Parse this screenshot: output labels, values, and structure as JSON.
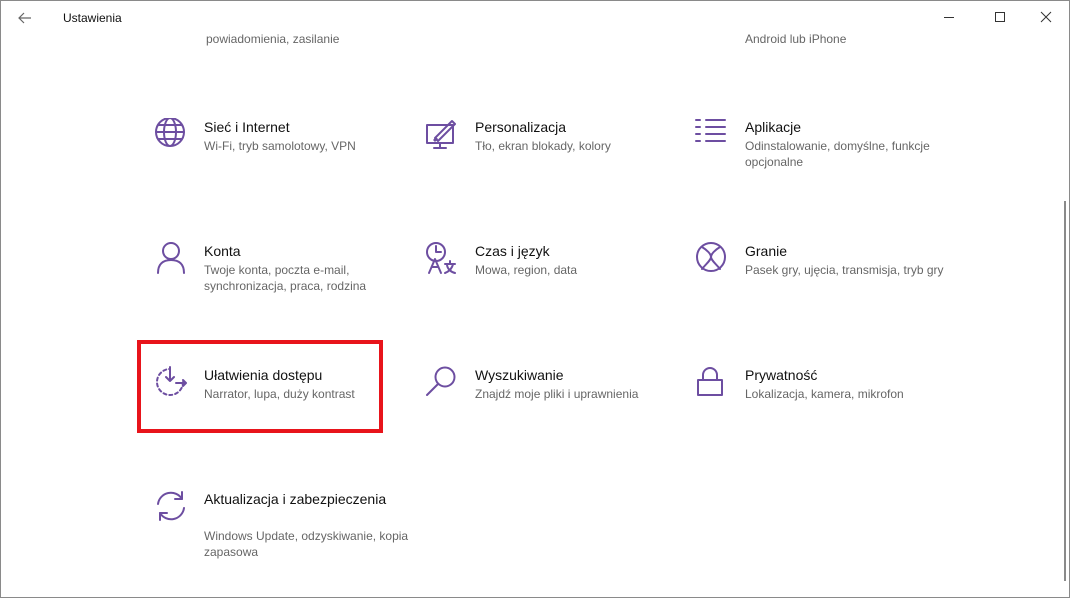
{
  "window": {
    "title": "Ustawienia"
  },
  "partial_row": {
    "left_desc": "powiadomienia, zasilanie",
    "right_desc": "Android lub iPhone"
  },
  "tiles": {
    "network": {
      "name": "Sieć i Internet",
      "desc": "Wi-Fi, tryb samolotowy, VPN",
      "icon": "globe-icon"
    },
    "personalization": {
      "name": "Personalizacja",
      "desc": "Tło, ekran blokady, kolory",
      "icon": "paint-icon"
    },
    "apps": {
      "name": "Aplikacje",
      "desc": "Odinstalowanie, domyślne, funkcje opcjonalne",
      "icon": "apps-list-icon"
    },
    "accounts": {
      "name": "Konta",
      "desc": "Twoje konta, poczta e-mail, synchronizacja, praca, rodzina",
      "icon": "person-icon"
    },
    "time": {
      "name": "Czas i język",
      "desc": "Mowa, region, data",
      "icon": "time-language-icon"
    },
    "gaming": {
      "name": "Granie",
      "desc": "Pasek gry, ujęcia, transmisja, tryb gry",
      "icon": "xbox-icon"
    },
    "ease": {
      "name": "Ułatwienia dostępu",
      "desc": "Narrator, lupa, duży kontrast",
      "icon": "ease-of-access-icon"
    },
    "search": {
      "name": "Wyszukiwanie",
      "desc": "Znajdź moje pliki i uprawnienia",
      "icon": "magnifier-icon"
    },
    "privacy": {
      "name": "Prywatność",
      "desc": "Lokalizacja, kamera, mikrofon",
      "icon": "lock-icon"
    },
    "update": {
      "name": "Aktualizacja i zabezpieczenia",
      "desc": "Windows Update, odzyskiwanie, kopia zapasowa",
      "icon": "sync-icon"
    }
  },
  "colors": {
    "accent": "#6d4ea1",
    "highlight": "#e8141b"
  }
}
